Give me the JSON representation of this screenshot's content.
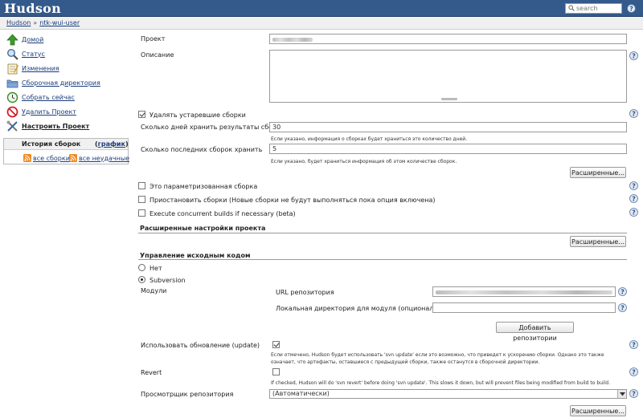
{
  "header": {
    "app_title": "Hudson",
    "search_placeholder": "search"
  },
  "breadcrumb": {
    "home": "Hudson",
    "separator": "»",
    "job": "ntk-wui-user"
  },
  "sidebar": {
    "items": [
      {
        "label": "Домой",
        "icon": "home-up-arrow-icon"
      },
      {
        "label": "Статус",
        "icon": "magnifier-icon"
      },
      {
        "label": "Изменения",
        "icon": "notepad-icon"
      },
      {
        "label": "Сборочная директория",
        "icon": "folder-icon"
      },
      {
        "label": "Собрать сейчас",
        "icon": "clock-build-icon"
      },
      {
        "label": "Удалить Проект",
        "icon": "no-entry-icon"
      },
      {
        "label": "Настроить Проект",
        "icon": "wrench-screwdriver-icon"
      }
    ],
    "history": {
      "title": "История сборок",
      "trend_open": "(",
      "trend_label": "график",
      "trend_close": ")",
      "all_builds": "все сборки",
      "failed_builds": "все неудачные"
    }
  },
  "form": {
    "project_label": "Проект",
    "description_label": "Описание",
    "discard_old_label": "Удалять устаревшие сборки",
    "days_label": "Сколько дней хранить результаты сборки",
    "days_value": "30",
    "days_note": "Если указано, информация о сборках будет храниться это количество дней.",
    "num_label": "Сколько последних сборок хранить",
    "num_value": "5",
    "num_note": "Если указано, будет храниться информация об этом количестве сборок.",
    "advanced_button": "Расширенные...",
    "parameterized_label": "Это параметризованная сборка",
    "disable_label": "Приостановить сборки (Новые сборки не будут выполняться пока опция включена)",
    "concurrent_label": "Execute concurrent builds if necessary (beta)",
    "advanced_section": "Расширенные настройки проекта",
    "scm_section": "Управление исходным кодом",
    "scm_none": "Нет",
    "scm_svn": "Subversion",
    "modules_label": "Модули",
    "repo_url_label": "URL репозитория",
    "local_dir_label": "Локальная директория для модуля (опционально)",
    "add_repo_button": "Добавить репозитории",
    "use_update_label": "Использовать обновление (update)",
    "use_update_note": "Если отмечено, Hudson будет использовать 'svn update' если это возможно, что приведет к ускорению сборки. Однако это также означает, что артефакты, оставшиеся с предыдущей сборки, также останутся в сборочной директории.",
    "revert_label": "Revert",
    "revert_note": "If checked, Hudson will do 'svn revert' before doing 'svn update'. This slows it down, but will prevent files being modified from build to build.",
    "browser_label": "Просмотрщик репозитория",
    "browser_value": "(Автоматически)"
  },
  "colors": {
    "header": "#34598b",
    "link": "#1a3d7c",
    "breadcrumb_bg": "#f0f0f0",
    "feed": "#f08a24"
  }
}
